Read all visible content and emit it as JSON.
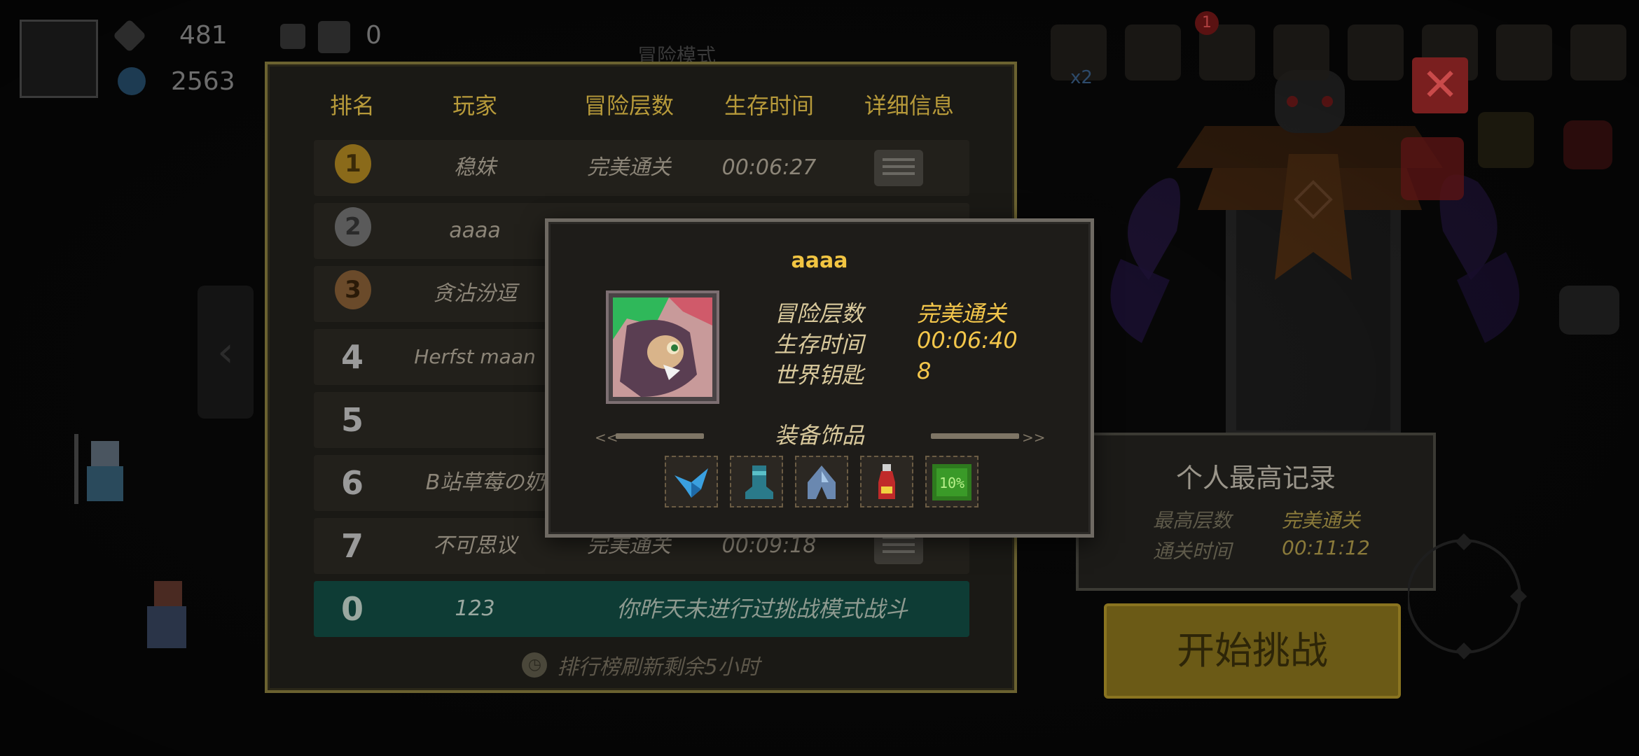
{
  "topbar": {
    "gems": "481",
    "coins": "2563",
    "mail_count": "0",
    "mode_title": "冒险模式",
    "badge": "1",
    "multiplier": "x2"
  },
  "leaderboard": {
    "headers": [
      "排名",
      "玩家",
      "冒险层数",
      "生存时间",
      "详细信息"
    ],
    "rows": [
      {
        "rank": "1",
        "name": "稳妹",
        "floors": "完美通关",
        "time": "00:06:27"
      },
      {
        "rank": "2",
        "name": "aaaa",
        "floors": "",
        "time": ""
      },
      {
        "rank": "3",
        "name": "贪沾汾逗",
        "floors": "",
        "time": ""
      },
      {
        "rank": "4",
        "name": "Herfst maan",
        "floors": "",
        "time": ""
      },
      {
        "rank": "5",
        "name": "",
        "floors": "",
        "time": ""
      },
      {
        "rank": "6",
        "name": "B站草莓の奶茶",
        "floors": "",
        "time": ""
      },
      {
        "rank": "7",
        "name": "不可思议",
        "floors": "完美通关",
        "time": "00:09:18"
      }
    ],
    "self_row": {
      "rank": "0",
      "name": "123",
      "message": "你昨天未进行过挑战模式战斗"
    },
    "refresh_text": "排行榜刷新剩余5小时"
  },
  "personal_best": {
    "title": "个人最高记录",
    "floor_label": "最高层数",
    "floor_value": "完美通关",
    "time_label": "通关时间",
    "time_value": "00:11:12"
  },
  "start_button": {
    "label": "开始挑战"
  },
  "modal": {
    "player_name": "aaaa",
    "floor_label": "冒险层数",
    "floor_value": "完美通关",
    "time_label": "生存时间",
    "time_value": "00:06:40",
    "key_label": "世界钥匙",
    "key_value": "8",
    "equip_title": "装备饰品",
    "equipment": [
      "blue-bird-icon",
      "boot-icon",
      "armor-icon",
      "potion-icon",
      "green-ten-percent-icon"
    ],
    "equip_badge": "10%"
  },
  "colors": {
    "gold": "#f3c64b",
    "panel_border": "#6b6230",
    "self_row": "#0e3c35",
    "start_button": "#6b5a16"
  }
}
